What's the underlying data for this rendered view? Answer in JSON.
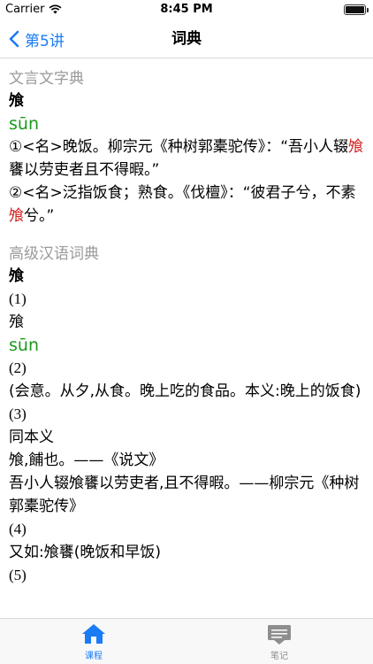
{
  "status_bar": {
    "carrier": "Carrier",
    "time": "8:45 PM"
  },
  "nav": {
    "back_label": "第5讲",
    "title": "词典"
  },
  "section1": {
    "title": "文言文字典",
    "headword": "飧",
    "pinyin": "sūn",
    "def1": {
      "pre": "①<名>晚饭。柳宗元《种树郭橐驼传》：“吾小人辍",
      "hl": "飧",
      "post": "饔以劳吏者且不得暇。”"
    },
    "def2": {
      "pre": "②<名>泛指饭食；熟食。《伐檀》：“彼君子兮，不素",
      "hl": "飧",
      "post": "兮。”"
    }
  },
  "section2": {
    "title": "高级汉语词典",
    "headword": "飧",
    "n1": "(1)",
    "variant": "飱",
    "pinyin": "sūn",
    "n2": "(2)",
    "line_etym": "(会意。从夕,从食。晚上吃的食品。本义:晚上的饭食)",
    "n3": "(3)",
    "line_same": "同本义",
    "line_quote1": "飧,餔也。——《说文》",
    "line_quote2": "吾小人辍飧饔以劳吏者,且不得暇。——柳宗元《种树郭橐驼传》",
    "n4": "(4)",
    "line_example": "又如:飧饔(晚饭和早饭)",
    "n5": "(5)"
  },
  "tabs": [
    {
      "label": "课程",
      "icon": "home-icon"
    },
    {
      "label": "笔记",
      "icon": "notes-icon"
    }
  ],
  "colors": {
    "accent": "#1a7cf5",
    "pinyin": "#1a9a1a",
    "highlight": "#d21f1f",
    "section_title": "#9a9a9a"
  }
}
